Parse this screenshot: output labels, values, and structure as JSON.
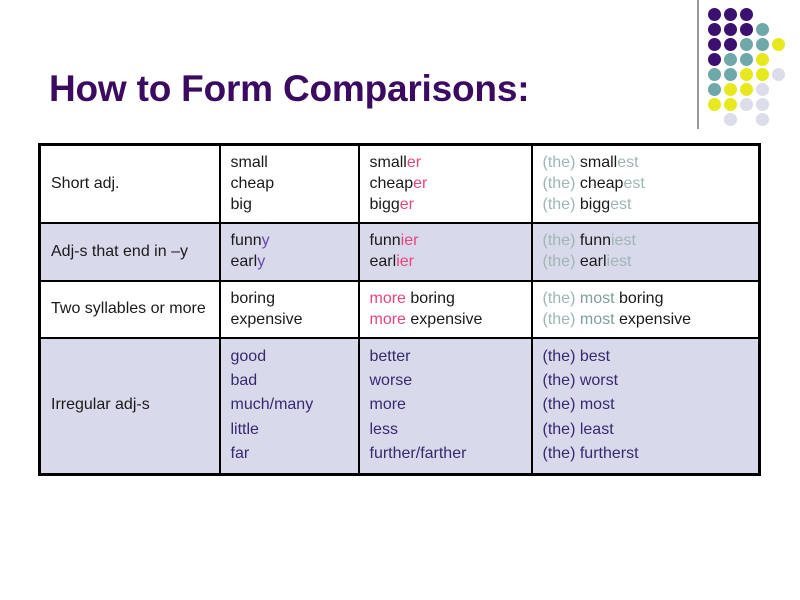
{
  "title": "How to Form Comparisons:",
  "colors": {
    "title": "#3B0B62",
    "accent_comparative": "#E8457C",
    "accent_superlative": "#9fb6b4",
    "irregular_text": "#352a6e",
    "row_tint": "#d9d9ec",
    "dot_purple": "#3B1070",
    "dot_teal": "#6FA8A8",
    "dot_yellow": "#E8E81E",
    "dot_pale": "#dcdcea"
  },
  "decoration": {
    "name": "dot-grid",
    "rows": [
      [
        "purple",
        "purple",
        "purple",
        "none",
        "none"
      ],
      [
        "purple",
        "purple",
        "purple",
        "teal",
        "none"
      ],
      [
        "purple",
        "purple",
        "teal",
        "teal",
        "yellow"
      ],
      [
        "purple",
        "teal",
        "teal",
        "yellow",
        "none"
      ],
      [
        "teal",
        "teal",
        "yellow",
        "yellow",
        "pale"
      ],
      [
        "teal",
        "yellow",
        "yellow",
        "pale",
        "none"
      ],
      [
        "yellow",
        "yellow",
        "pale",
        "pale",
        "none"
      ],
      [
        "none",
        "pale",
        "none",
        "pale",
        "none"
      ]
    ]
  },
  "table": {
    "rows": [
      {
        "id": "short-adj",
        "tint": "white",
        "rule": "Short adj.",
        "base": [
          "small",
          "cheap",
          "big"
        ],
        "comparative": [
          {
            "stem": "small",
            "suffix": "er"
          },
          {
            "stem": "cheap",
            "suffix": "er"
          },
          {
            "stem": "bigg",
            "suffix": "er"
          }
        ],
        "superlative": [
          {
            "the": "(the)",
            "stem": "small",
            "suffix": "est"
          },
          {
            "the": "(the)",
            "stem": "cheap",
            "suffix": "est"
          },
          {
            "the": "(the)",
            "stem": "bigg",
            "suffix": "est"
          }
        ]
      },
      {
        "id": "ends-in-y",
        "tint": "lav",
        "rule": "Adj-s that end in –y",
        "base": [
          "funny",
          "early"
        ],
        "base_marked": [
          {
            "stem": "funn",
            "suffix": "y"
          },
          {
            "stem": "earl",
            "suffix": "y"
          }
        ],
        "comparative": [
          {
            "stem": "funn",
            "suffix": "ier"
          },
          {
            "stem": "earl",
            "suffix": "ier"
          }
        ],
        "superlative": [
          {
            "the": "(the)",
            "stem": "funn",
            "suffix": "iest"
          },
          {
            "the": "(the)",
            "stem": "earl",
            "suffix": "iest"
          }
        ]
      },
      {
        "id": "two-syllables",
        "tint": "white",
        "rule": "Two syllables or more",
        "base": [
          "boring",
          "expensive"
        ],
        "comparative_words": [
          {
            "marker": "more",
            "word": "boring"
          },
          {
            "marker": "more",
            "word": "expensive"
          }
        ],
        "superlative_words": [
          {
            "the": "(the)",
            "marker": "most",
            "word": "boring"
          },
          {
            "the": "(the)",
            "marker": "most",
            "word": "expensive"
          }
        ]
      },
      {
        "id": "irregular",
        "tint": "lav",
        "rule": "Irregular adj-s",
        "base": [
          "good",
          "bad",
          "much/many",
          "little",
          "far"
        ],
        "comparative_plain": [
          "better",
          "worse",
          "more",
          "less",
          "further/farther"
        ],
        "superlative_plain": [
          "(the) best",
          "(the) worst",
          "(the) most",
          "(the) least",
          "(the) furtherst"
        ]
      }
    ]
  }
}
